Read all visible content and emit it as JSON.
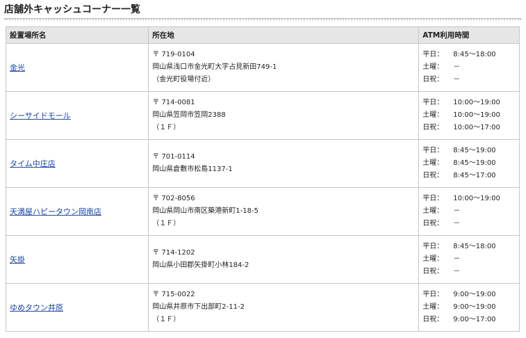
{
  "page": {
    "title": "店舗外キャッシュコーナー一覧"
  },
  "table": {
    "headers": {
      "name": "設置場所名",
      "address": "所在地",
      "hours": "ATM利用時間"
    },
    "rows": [
      {
        "name": "金光",
        "postal": "〒 719-0104",
        "address": "岡山県浅口市金光町大字占見新田749-1",
        "note": "（金光町役場付近）",
        "hours": [
          {
            "label": "平日：",
            "value": "8:45～18:00"
          },
          {
            "label": "土曜：",
            "value": "－"
          },
          {
            "label": "日祝：",
            "value": "－"
          }
        ]
      },
      {
        "name": "シーサイドモール",
        "postal": "〒 714-0081",
        "address": "岡山県笠岡市笠岡2388",
        "note": "（１Ｆ）",
        "hours": [
          {
            "label": "平日：",
            "value": "10:00～19:00"
          },
          {
            "label": "土曜：",
            "value": "10:00～19:00"
          },
          {
            "label": "日祝：",
            "value": "10:00～17:00"
          }
        ]
      },
      {
        "name": "タイム中庄店",
        "postal": "〒 701-0114",
        "address": "岡山県倉敷市松島1137-1",
        "note": "",
        "hours": [
          {
            "label": "平日：",
            "value": "8:45～19:00"
          },
          {
            "label": "土曜：",
            "value": "8:45～19:00"
          },
          {
            "label": "日祝：",
            "value": "8:45～17:00"
          }
        ]
      },
      {
        "name": "天満屋ハピータウン岡南店",
        "postal": "〒 702-8056",
        "address": "岡山県岡山市南区築港新町1-18-5",
        "note": "（１Ｆ）",
        "hours": [
          {
            "label": "平日：",
            "value": "10:00～19:00"
          },
          {
            "label": "土曜：",
            "value": "－"
          },
          {
            "label": "日祝：",
            "value": "－"
          }
        ]
      },
      {
        "name": "矢掛",
        "postal": "〒 714-1202",
        "address": "岡山県小田郡矢掛町小林184-2",
        "note": "",
        "hours": [
          {
            "label": "平日：",
            "value": "8:45～18:00"
          },
          {
            "label": "土曜：",
            "value": "－"
          },
          {
            "label": "日祝：",
            "value": "－"
          }
        ]
      },
      {
        "name": "ゆめタウン井原",
        "postal": "〒 715-0022",
        "address": "岡山県井原市下出部町2-11-2",
        "note": "（１Ｆ）",
        "hours": [
          {
            "label": "平日：",
            "value": "9:00～19:00"
          },
          {
            "label": "土曜：",
            "value": "9:00～19:00"
          },
          {
            "label": "日祝：",
            "value": "9:00～17:00"
          }
        ]
      }
    ]
  },
  "colors": {
    "link": "#1a44a8",
    "header_bg": "#e6e6e6",
    "border": "#c6c6c6",
    "text": "#222222"
  }
}
